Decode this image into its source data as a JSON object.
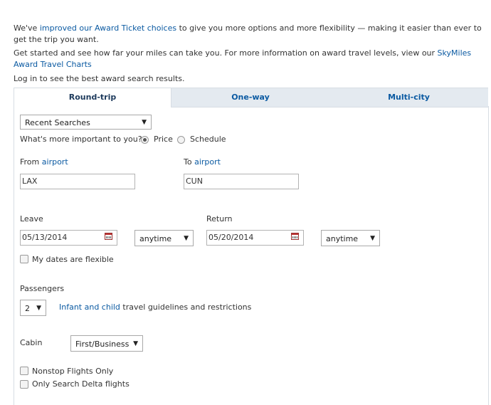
{
  "intro": {
    "line1_pre": "We've ",
    "line1_link": "improved our Award Ticket choices",
    "line1_post": " to give you more options and more flexibility — making it easier than ever to get the trip you want.",
    "line2_pre": "Get started and see how far your miles can take you. For more information on award travel levels, view our ",
    "line2_link": "SkyMiles Award Travel Charts",
    "line3": "Log in to see the best award search results."
  },
  "tabs": [
    {
      "label": "Round-trip",
      "active": true
    },
    {
      "label": "One-way",
      "active": false
    },
    {
      "label": "Multi-city",
      "active": false
    }
  ],
  "form": {
    "recent_searches": "Recent Searches",
    "importance_label": "What's more important to you?",
    "price_label": "Price",
    "schedule_label": "Schedule",
    "from_label": "From",
    "to_label": "To",
    "airport_link": "airport",
    "from_value": "LAX",
    "to_value": "CUN",
    "leave_label": "Leave",
    "return_label": "Return",
    "leave_date": "05/13/2014",
    "return_date": "05/20/2014",
    "leave_time": "anytime",
    "return_time": "anytime",
    "flexible_label": "My dates are flexible",
    "passengers_label": "Passengers",
    "passengers_value": "2",
    "infant_link": "Infant and child",
    "infant_text": " travel guidelines and restrictions",
    "cabin_label": "Cabin",
    "cabin_value": "First/Business",
    "nonstop_label": "Nonstop Flights Only",
    "delta_only_label": "Only Search Delta flights"
  }
}
